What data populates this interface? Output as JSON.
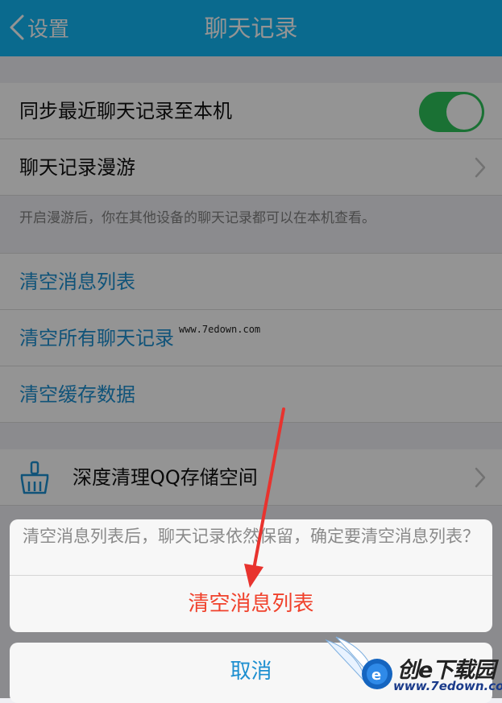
{
  "navbar": {
    "back_label": "设置",
    "title": "聊天记录"
  },
  "settings": {
    "sync_label": "同步最近聊天记录至本机",
    "sync_enabled": true,
    "roam_label": "聊天记录漫游",
    "roam_hint": "开启漫游后，你在其他设备的聊天记录都可以在本机查看。",
    "clear_list_label": "清空消息列表",
    "clear_all_label": "清空所有聊天记录",
    "clear_cache_label": "清空缓存数据",
    "deep_clean_label": "深度清理QQ存储空间"
  },
  "action_sheet": {
    "message": "清空消息列表后，聊天记录依然保留，确定要清空消息列表？",
    "confirm_label": "清空消息列表",
    "cancel_label": "取消"
  },
  "watermarks": {
    "url_text": "www.7edown.com",
    "logo_name": "创e下载园",
    "logo_url": "www.7edown.com"
  },
  "colors": {
    "navbar": "#12b7f5",
    "toggle_on": "#2ec35b",
    "link_blue": "#1d8fd0",
    "danger_red": "#f0412b",
    "arrow_red": "#e8332e"
  }
}
